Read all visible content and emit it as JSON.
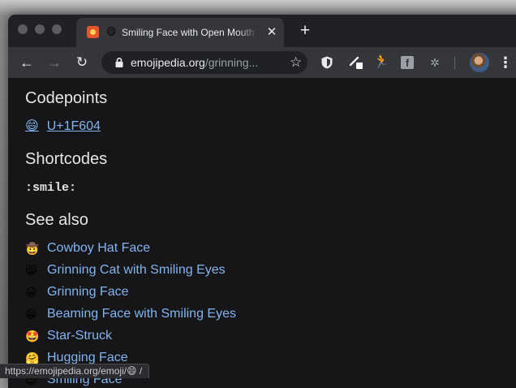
{
  "browser": {
    "tab": {
      "favicon": "emojipedia-favicon",
      "emoji": "😄",
      "title": "Smiling Face with Open Mouth and Smiling Eyes",
      "close_glyph": "✕"
    },
    "new_tab_glyph": "+",
    "toolbar": {
      "back_glyph": "←",
      "forward_glyph": "→",
      "reload_glyph": "↻",
      "url_domain": "emojipedia.org",
      "url_path": "/grinning...",
      "star_glyph": "☆",
      "extensions": [
        "shield-icon",
        "pen-icon",
        "figure-icon",
        "facebook-icon",
        "puzzle-icon"
      ],
      "facebook_glyph": "f",
      "figure_glyph": "🏃",
      "puzzle_glyph": "✲",
      "menu_glyph": "⋮"
    }
  },
  "page": {
    "codepoints": {
      "heading": "Codepoints",
      "emoji": "😄",
      "value": "U+1F604"
    },
    "shortcodes": {
      "heading": "Shortcodes",
      "value": ":smile:"
    },
    "see_also": {
      "heading": "See also",
      "items": [
        {
          "emoji": "🤠",
          "name": "Cowboy Hat Face"
        },
        {
          "emoji": "😸",
          "name": "Grinning Cat with Smiling Eyes"
        },
        {
          "emoji": "😀",
          "name": "Grinning Face"
        },
        {
          "emoji": "😁",
          "name": "Beaming Face with Smiling Eyes"
        },
        {
          "emoji": "🤩",
          "name": "Star-Struck"
        },
        {
          "emoji": "🤗",
          "name": "Hugging Face"
        },
        {
          "emoji": "😊",
          "name": "Smiling Face"
        }
      ]
    }
  },
  "status_bar": {
    "text": "https://emojipedia.org/emoji/😄 /"
  },
  "colors": {
    "page_bg": "#161618",
    "link": "#82b4f0",
    "toolbar": "#35363a",
    "tabstrip": "#202124"
  }
}
